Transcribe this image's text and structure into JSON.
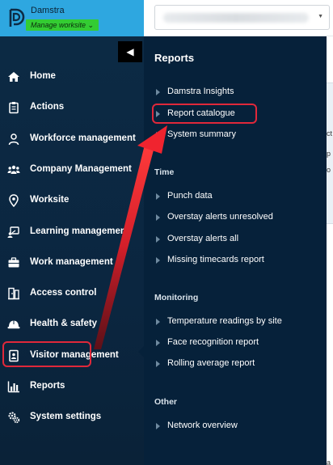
{
  "brand": {
    "org_name": "Damstra",
    "manage_button": "Manage worksite ⌄"
  },
  "topbar": {
    "site_select_caret": "▼"
  },
  "sidebar": {
    "collapse_glyph": "◀",
    "items": [
      {
        "label": "Home",
        "icon": "home-icon"
      },
      {
        "label": "Actions",
        "icon": "clipboard-icon"
      },
      {
        "label": "Workforce management",
        "icon": "user-icon"
      },
      {
        "label": "Company Management",
        "icon": "group-icon"
      },
      {
        "label": "Worksite",
        "icon": "location-pin-icon"
      },
      {
        "label": "Learning management",
        "icon": "learning-icon"
      },
      {
        "label": "Work management",
        "icon": "briefcase-icon"
      },
      {
        "label": "Access control",
        "icon": "access-icon"
      },
      {
        "label": "Health & safety",
        "icon": "hard-hat-icon"
      },
      {
        "label": "Visitor management",
        "icon": "badge-icon"
      },
      {
        "label": "Reports",
        "icon": "bar-chart-icon",
        "active": true
      },
      {
        "label": "System settings",
        "icon": "gears-icon"
      }
    ]
  },
  "flyout": {
    "title": "Reports",
    "groups": [
      {
        "heading": "",
        "items": [
          "Damstra Insights",
          "Report catalogue",
          "System summary"
        ]
      },
      {
        "heading": "Time",
        "items": [
          "Punch data",
          "Overstay alerts unresolved",
          "Overstay alerts all",
          "Missing timecards report"
        ]
      },
      {
        "heading": "Monitoring",
        "items": [
          "Temperature readings by site",
          "Face recognition report",
          "Rolling average report"
        ]
      },
      {
        "heading": "Other",
        "items": [
          "Network overview"
        ]
      }
    ]
  },
  "edge_glyphs": [
    "ct",
    "p",
    "o",
    "a"
  ],
  "colors": {
    "accent_blue": "#2ea7e0",
    "manage_green": "#33cc33",
    "highlight_red": "#e0283a",
    "sidebar_bg": "#0c2a44",
    "flyout_bg": "#06213a"
  }
}
